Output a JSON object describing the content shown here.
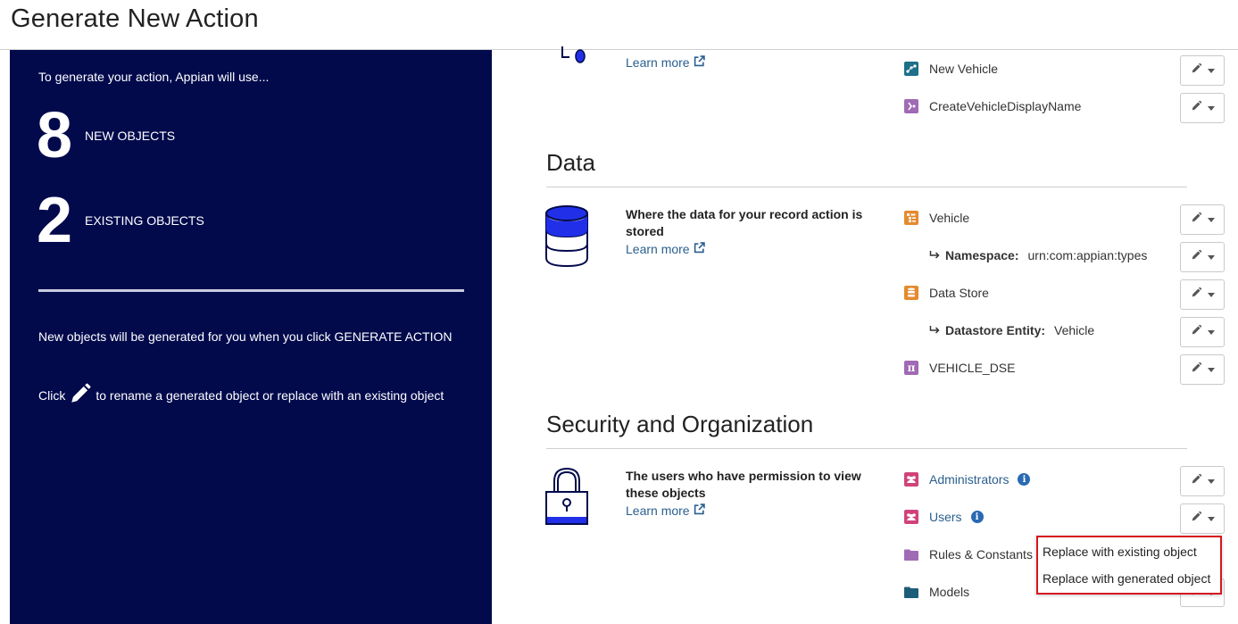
{
  "header": {
    "title": "Generate New Action"
  },
  "summary": {
    "intro": "To generate your action, Appian will use...",
    "new_count": "8",
    "new_label": "NEW OBJECTS",
    "existing_count": "2",
    "existing_label": "EXISTING OBJECTS",
    "note1": "New objects will be generated for you when you click GENERATE ACTION",
    "note2_prefix": "Click",
    "note2_suffix": "to rename a generated object or replace with an existing object"
  },
  "sections": {
    "top": {
      "learn_more": "Learn more",
      "objects": [
        {
          "name": "New Vehicle",
          "icon": "process-model-icon",
          "color": "#1d6f8a"
        },
        {
          "name": "CreateVehicleDisplayName",
          "icon": "expression-rule-icon",
          "color": "#a06ab4"
        }
      ]
    },
    "data": {
      "title": "Data",
      "description": "Where the data for your record action is stored",
      "learn_more": "Learn more",
      "objects": [
        {
          "name": "Vehicle",
          "icon": "data-type-icon",
          "color": "#e58a2e"
        },
        {
          "name": "Data Store",
          "icon": "data-store-icon",
          "color": "#e58a2e"
        },
        {
          "name": "VEHICLE_DSE",
          "icon": "constant-icon",
          "color": "#a06ab4"
        }
      ],
      "namespace_label": "Namespace:",
      "namespace_value": "urn:com:appian:types",
      "entity_label": "Datastore Entity:",
      "entity_value": "Vehicle"
    },
    "security": {
      "title": "Security and Organization",
      "description": "The users who have permission to view these objects",
      "learn_more": "Learn more",
      "objects": [
        {
          "name": "Administrators",
          "icon": "group-icon",
          "color": "#d0437a"
        },
        {
          "name": "Users",
          "icon": "group-icon",
          "color": "#d0437a"
        },
        {
          "name": "Rules & Constants",
          "icon": "folder-icon",
          "color": "#a06ab4"
        },
        {
          "name": "Models",
          "icon": "folder-icon",
          "color": "#1d5d7a"
        }
      ]
    }
  },
  "dropdown_menu": {
    "items": [
      "Replace with existing object",
      "Replace with generated object"
    ]
  },
  "colors": {
    "panel": "#020a4c",
    "link": "#2a5f8f",
    "highlight": "#d6161e"
  }
}
